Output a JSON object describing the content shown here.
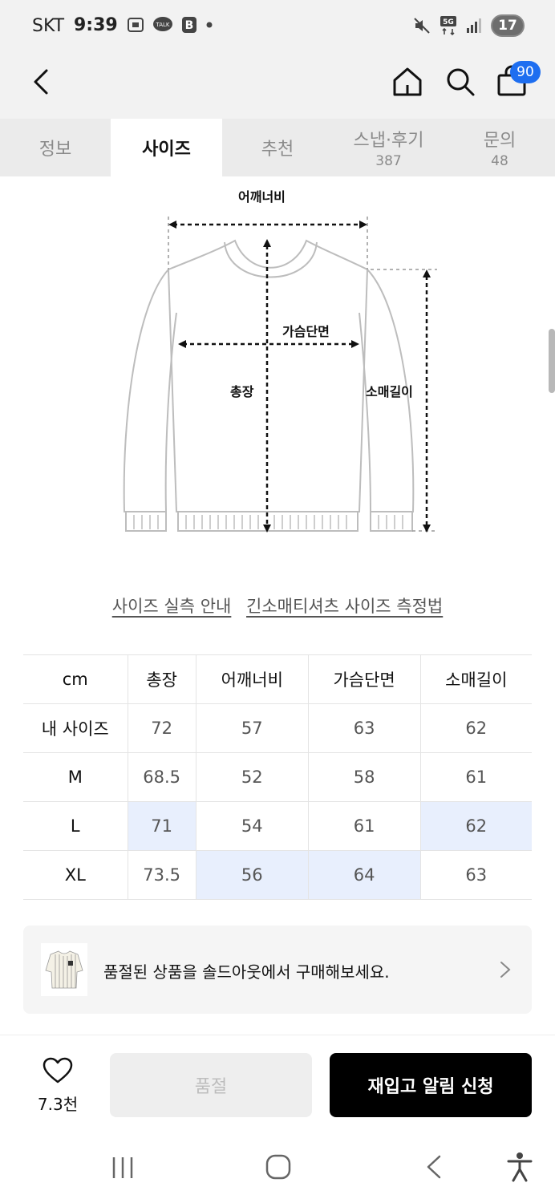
{
  "status_bar": {
    "carrier": "SKT",
    "time": "9:39",
    "battery": "17"
  },
  "header": {
    "cart_count": "90"
  },
  "tabs": [
    {
      "label": "정보",
      "count": ""
    },
    {
      "label": "사이즈",
      "count": ""
    },
    {
      "label": "추천",
      "count": ""
    },
    {
      "label": "스냅·후기",
      "count": "387"
    },
    {
      "label": "문의",
      "count": "48"
    }
  ],
  "diagram": {
    "shoulder": "어깨너비",
    "chest": "가슴단면",
    "length": "총장",
    "sleeve": "소매길이"
  },
  "links": {
    "size_guide": "사이즈 실측 안내",
    "measure_method": "긴소매티셔츠 사이즈 측정법"
  },
  "size_table": {
    "headers": [
      "cm",
      "총장",
      "어깨너비",
      "가슴단면",
      "소매길이"
    ],
    "rows": [
      [
        "내 사이즈",
        "72",
        "57",
        "63",
        "62"
      ],
      [
        "M",
        "68.5",
        "52",
        "58",
        "61"
      ],
      [
        "L",
        "71",
        "54",
        "61",
        "62"
      ],
      [
        "XL",
        "73.5",
        "56",
        "64",
        "63"
      ]
    ]
  },
  "banner": {
    "text": "품절된 상품을 솔드아웃에서 구매해보세요."
  },
  "actions": {
    "like_count": "7.3천",
    "soldout": "품절",
    "restock": "재입고 알림 신청"
  },
  "colors": {
    "highlight": "#e8effd",
    "badge": "#1e6ef0",
    "primary_button": "#000000"
  }
}
